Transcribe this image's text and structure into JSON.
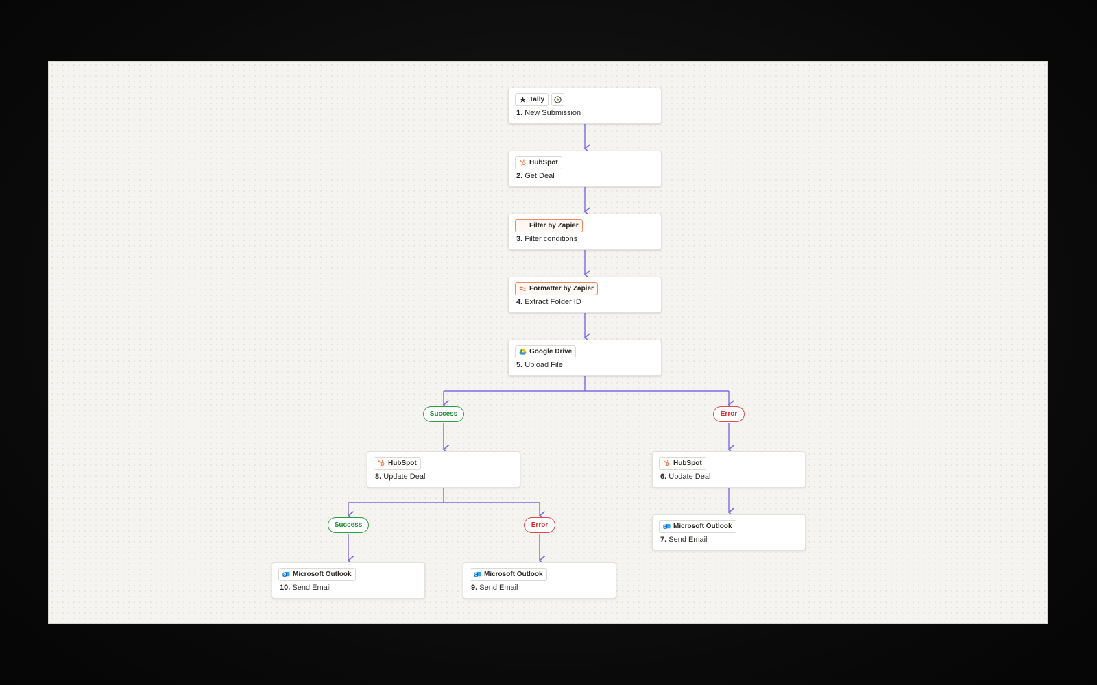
{
  "colors": {
    "connector": "#7b6ce0",
    "success": "#2ea043",
    "error": "#e5484d",
    "formatter_accent": "#f08a5d"
  },
  "nodes": [
    {
      "id": "n1",
      "app": "Tally",
      "app_icon": "tally-star-icon",
      "num": "1.",
      "label": "New Submission"
    },
    {
      "id": "n2",
      "app": "HubSpot",
      "app_icon": "hubspot-icon",
      "num": "2.",
      "label": "Get Deal"
    },
    {
      "id": "n3",
      "app": "Filter by Zapier",
      "app_icon": "filter-icon",
      "num": "3.",
      "label": "Filter conditions"
    },
    {
      "id": "n4",
      "app": "Formatter by Zapier",
      "app_icon": "formatter-icon",
      "num": "4.",
      "label": "Extract Folder ID"
    },
    {
      "id": "n5",
      "app": "Google Drive",
      "app_icon": "google-drive-icon",
      "num": "5.",
      "label": "Upload File"
    },
    {
      "id": "n8",
      "app": "HubSpot",
      "app_icon": "hubspot-icon",
      "num": "8.",
      "label": "Update Deal"
    },
    {
      "id": "n6",
      "app": "HubSpot",
      "app_icon": "hubspot-icon",
      "num": "6.",
      "label": "Update Deal"
    },
    {
      "id": "n7",
      "app": "Microsoft Outlook",
      "app_icon": "outlook-icon",
      "num": "7.",
      "label": "Send Email"
    },
    {
      "id": "n10",
      "app": "Microsoft Outlook",
      "app_icon": "outlook-icon",
      "num": "10.",
      "label": "Send Email"
    },
    {
      "id": "n9",
      "app": "Microsoft Outlook",
      "app_icon": "outlook-icon",
      "num": "9.",
      "label": "Send Email"
    }
  ],
  "branches": {
    "b1_success": "Success",
    "b1_error": "Error",
    "b2_success": "Success",
    "b2_error": "Error"
  }
}
